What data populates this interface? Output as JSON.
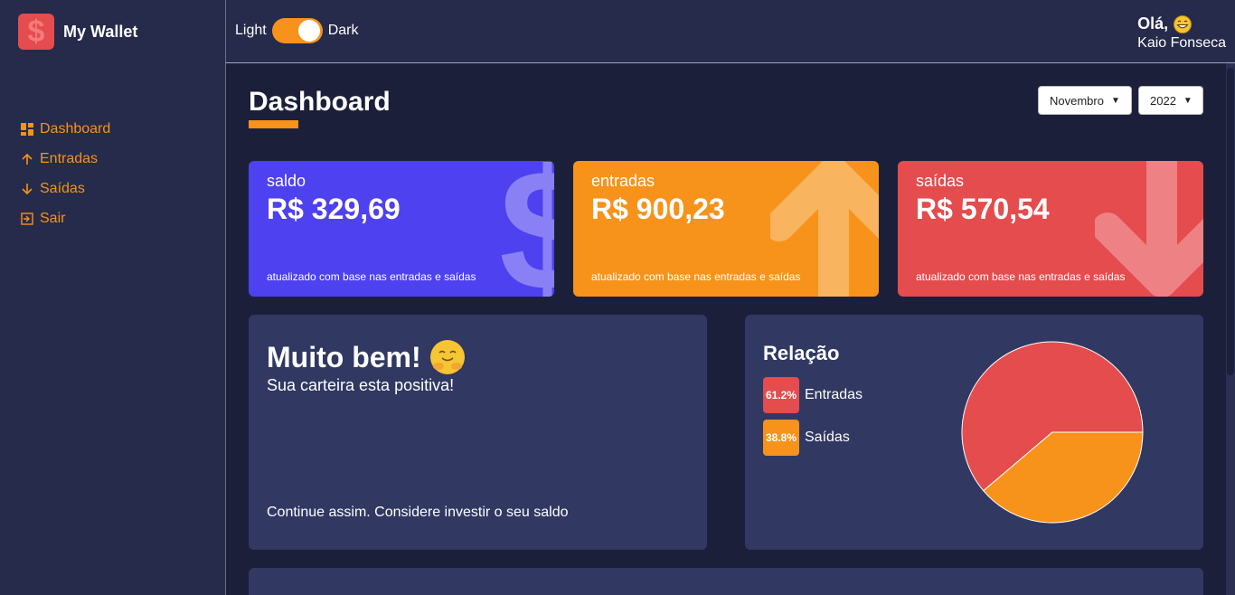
{
  "app": {
    "name": "My Wallet",
    "logo_symbol": "$",
    "brand_color": "#e44c4e",
    "accent_color": "#f7931b"
  },
  "sidebar": {
    "items": [
      {
        "label": "Dashboard",
        "icon": "dashboard-icon"
      },
      {
        "label": "Entradas",
        "icon": "arrow-up-icon"
      },
      {
        "label": "Saídas",
        "icon": "arrow-down-icon"
      },
      {
        "label": "Sair",
        "icon": "logout-icon"
      }
    ]
  },
  "header": {
    "theme_light_label": "Light",
    "theme_dark_label": "Dark",
    "theme_dark_enabled": true,
    "greeting": "Olá,",
    "user_name": "Kaio Fonseca"
  },
  "main": {
    "title": "Dashboard",
    "month_select": "Novembro",
    "year_select": "2022"
  },
  "cards": [
    {
      "title": "saldo",
      "value": "R$ 329,69",
      "footer": "atualizado com base nas entradas e saídas",
      "color": "#4e41f0",
      "icon": "dollar-icon"
    },
    {
      "title": "entradas",
      "value": "R$ 900,23",
      "footer": "atualizado com base nas entradas e saídas",
      "color": "#f7931b",
      "icon": "arrow-up-icon"
    },
    {
      "title": "saídas",
      "value": "R$ 570,54",
      "footer": "atualizado com base nas entradas e saídas",
      "color": "#e44c4e",
      "icon": "arrow-down-icon"
    }
  ],
  "message": {
    "title": "Muito bem!",
    "subtitle": "Sua carteira esta positiva!",
    "footer": "Continue assim. Considere investir o seu saldo",
    "emoji": "hugging-face-icon"
  },
  "relation": {
    "title": "Relação",
    "items": [
      {
        "label": "Entradas",
        "percent": "61.2%",
        "value": 61.2,
        "color": "#e44c4e"
      },
      {
        "label": "Saídas",
        "percent": "38.8%",
        "value": 38.8,
        "color": "#f7931b"
      }
    ]
  }
}
